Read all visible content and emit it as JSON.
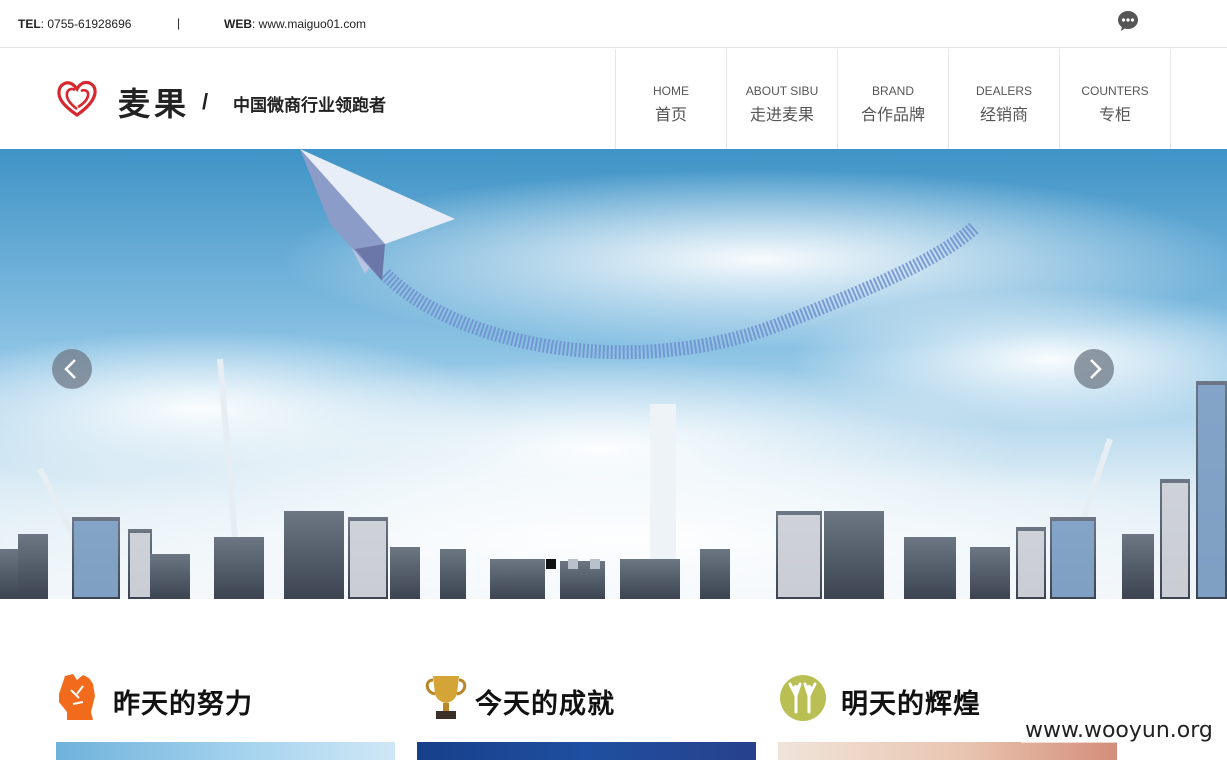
{
  "topbar": {
    "tel_label": "TEL",
    "tel_value": ": 0755-61928696",
    "separator": "|",
    "web_label": "WEB",
    "web_value": ": www.maiguo01.com"
  },
  "brand": {
    "name": "麦果",
    "slash": "/",
    "slogan": "中国微商行业领跑者",
    "logo_color": "#d7282f"
  },
  "nav": [
    {
      "en": "HOME",
      "cn": "首页"
    },
    {
      "en": "ABOUT SIBU",
      "cn": "走进麦果"
    },
    {
      "en": "BRAND",
      "cn": "合作品牌"
    },
    {
      "en": "DEALERS",
      "cn": "经销商"
    },
    {
      "en": "COUNTERS",
      "cn": "专柜"
    }
  ],
  "banner": {
    "slides": 3,
    "active_slide": 1,
    "prev_icon": "chevron-left-icon",
    "next_icon": "chevron-right-icon"
  },
  "sections": [
    {
      "title": "昨天的努力",
      "icon": "fist-icon",
      "icon_color": "#f26a1b"
    },
    {
      "title": "今天的成就",
      "icon": "trophy-icon",
      "icon_color": "#c99a2e"
    },
    {
      "title": "明天的辉煌",
      "icon": "people-cheer-icon",
      "icon_color": "#b9bf52"
    }
  ],
  "watermark": "www.wooyun.org"
}
